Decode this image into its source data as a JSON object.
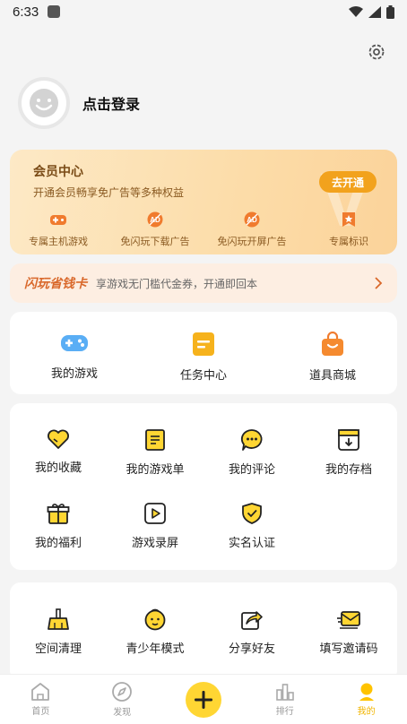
{
  "status_bar": {
    "time": "6:33"
  },
  "profile": {
    "login_text": "点击登录"
  },
  "vip": {
    "title": "会员中心",
    "subtitle": "开通会员畅享免广告等多种权益",
    "button": "去开通",
    "perks": [
      {
        "label": "专属主机游戏",
        "icon": "gamepad-plus-icon"
      },
      {
        "label": "免闪玩下载广告",
        "icon": "no-ad-icon"
      },
      {
        "label": "免闪玩开屏广告",
        "icon": "no-ad-icon"
      },
      {
        "label": "专属标识",
        "icon": "badge-star-icon"
      }
    ]
  },
  "saver": {
    "name": "闪玩省钱卡",
    "desc": "享游戏无门槛代金券，开通即回本"
  },
  "quick": [
    {
      "label": "我的游戏",
      "icon": "gamepad-icon"
    },
    {
      "label": "任务中心",
      "icon": "task-icon"
    },
    {
      "label": "道具商城",
      "icon": "shop-bag-icon"
    }
  ],
  "features": [
    {
      "label": "我的收藏",
      "icon": "heart-icon"
    },
    {
      "label": "我的游戏单",
      "icon": "list-icon"
    },
    {
      "label": "我的评论",
      "icon": "comment-icon"
    },
    {
      "label": "我的存档",
      "icon": "save-archive-icon"
    },
    {
      "label": "我的福利",
      "icon": "gift-icon"
    },
    {
      "label": "游戏录屏",
      "icon": "video-play-icon"
    },
    {
      "label": "实名认证",
      "icon": "shield-check-icon"
    }
  ],
  "tools": [
    {
      "label": "空间清理",
      "icon": "broom-icon"
    },
    {
      "label": "青少年模式",
      "icon": "child-face-icon"
    },
    {
      "label": "分享好友",
      "icon": "share-icon"
    },
    {
      "label": "填写邀请码",
      "icon": "invite-mail-icon"
    }
  ],
  "tabs": [
    {
      "label": "首页",
      "icon": "home-icon"
    },
    {
      "label": "发现",
      "icon": "compass-icon"
    },
    {
      "label": "",
      "icon": "plus-icon"
    },
    {
      "label": "排行",
      "icon": "bar-chart-icon"
    },
    {
      "label": "我的",
      "icon": "user-icon"
    }
  ],
  "colors": {
    "accent": "#f1b500",
    "vip_button": "#f2a21d",
    "saver_name": "#d9682b"
  }
}
